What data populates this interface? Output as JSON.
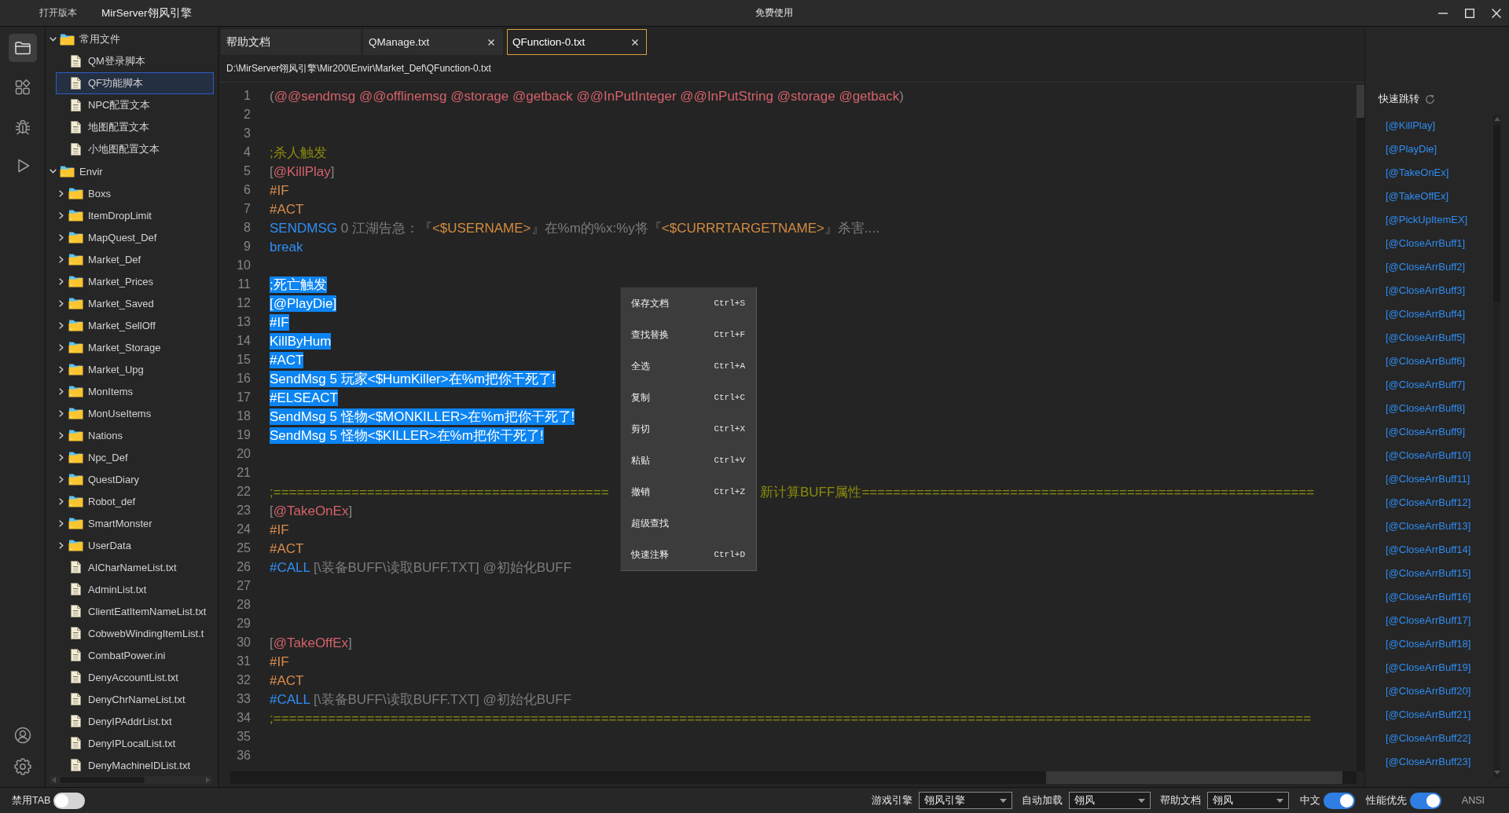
{
  "title_bar": {
    "menu": "打开版本",
    "app_name": "MirServer翎风引擎",
    "notice": "免费使用"
  },
  "activity_bar": {
    "top": [
      {
        "kind": "explorer",
        "selected": true
      },
      {
        "kind": "extensions",
        "selected": false
      },
      {
        "kind": "debug",
        "selected": false
      },
      {
        "kind": "run",
        "selected": false
      }
    ],
    "bottom": [
      {
        "kind": "account"
      },
      {
        "kind": "settings"
      }
    ]
  },
  "explorer": {
    "tree": [
      {
        "label": "常用文件",
        "kind": "folder",
        "expanded": true,
        "selected": false,
        "children": [
          {
            "label": "QM登录脚本",
            "kind": "file",
            "selected": false
          },
          {
            "label": "QF功能脚本",
            "kind": "file",
            "selected": true
          },
          {
            "label": "NPC配置文本",
            "kind": "file",
            "selected": false
          },
          {
            "label": "地图配置文本",
            "kind": "file",
            "selected": false
          },
          {
            "label": "小地图配置文本",
            "kind": "file",
            "selected": false
          }
        ]
      },
      {
        "label": "Envir",
        "kind": "folder",
        "expanded": true,
        "selected": false,
        "children": [
          {
            "label": "Boxs",
            "kind": "folder",
            "expanded": false,
            "selected": false
          },
          {
            "label": "ItemDropLimit",
            "kind": "folder",
            "expanded": false,
            "selected": false
          },
          {
            "label": "MapQuest_Def",
            "kind": "folder",
            "expanded": false,
            "selected": false
          },
          {
            "label": "Market_Def",
            "kind": "folder",
            "expanded": false,
            "selected": false
          },
          {
            "label": "Market_Prices",
            "kind": "folder",
            "expanded": false,
            "selected": false
          },
          {
            "label": "Market_Saved",
            "kind": "folder",
            "expanded": false,
            "selected": false
          },
          {
            "label": "Market_SellOff",
            "kind": "folder",
            "expanded": false,
            "selected": false
          },
          {
            "label": "Market_Storage",
            "kind": "folder",
            "expanded": false,
            "selected": false
          },
          {
            "label": "Market_Upg",
            "kind": "folder",
            "expanded": false,
            "selected": false
          },
          {
            "label": "MonItems",
            "kind": "folder",
            "expanded": false,
            "selected": false
          },
          {
            "label": "MonUseItems",
            "kind": "folder",
            "expanded": false,
            "selected": false
          },
          {
            "label": "Nations",
            "kind": "folder",
            "expanded": false,
            "selected": false
          },
          {
            "label": "Npc_Def",
            "kind": "folder",
            "expanded": false,
            "selected": false
          },
          {
            "label": "QuestDiary",
            "kind": "folder",
            "expanded": false,
            "selected": false
          },
          {
            "label": "Robot_def",
            "kind": "folder",
            "expanded": false,
            "selected": false
          },
          {
            "label": "SmartMonster",
            "kind": "folder",
            "expanded": false,
            "selected": false
          },
          {
            "label": "UserData",
            "kind": "folder",
            "expanded": false,
            "selected": false
          },
          {
            "label": "AICharNameList.txt",
            "kind": "file",
            "selected": false
          },
          {
            "label": "AdminList.txt",
            "kind": "file",
            "selected": false
          },
          {
            "label": "ClientEatItemNameList.txt",
            "kind": "file",
            "selected": false
          },
          {
            "label": "CobwebWindingItemList.t",
            "kind": "file",
            "selected": false
          },
          {
            "label": "CombatPower.ini",
            "kind": "file",
            "selected": false
          },
          {
            "label": "DenyAccountList.txt",
            "kind": "file",
            "selected": false
          },
          {
            "label": "DenyChrNameList.txt",
            "kind": "file",
            "selected": false
          },
          {
            "label": "DenyIPAddrList.txt",
            "kind": "file",
            "selected": false
          },
          {
            "label": "DenyIPLocalList.txt",
            "kind": "file",
            "selected": false
          },
          {
            "label": "DenyMachineIDList.txt",
            "kind": "file",
            "selected": false
          }
        ]
      }
    ]
  },
  "editor": {
    "tabs": [
      {
        "label": "帮助文档",
        "closable": false,
        "selected": false
      },
      {
        "label": "QManage.txt",
        "closable": true,
        "selected": false
      },
      {
        "label": "QFunction-0.txt",
        "closable": true,
        "selected": true
      }
    ],
    "path": "D:\\MirServer翎风引擎\\Mir200\\Envir\\Market_Def\\QFunction-0.txt",
    "lines": [
      {
        "number": "1",
        "selected": false,
        "segments": [
          {
            "kind": "punct",
            "text": "("
          },
          {
            "kind": "label",
            "text": "@@sendmsg @@offlinemsg @storage @getback @@InPutInteger @@InPutString @storage @getback"
          },
          {
            "kind": "punct",
            "text": ")"
          }
        ]
      },
      {
        "number": "2",
        "selected": false
      },
      {
        "number": "3",
        "selected": false
      },
      {
        "number": "4",
        "selected": false,
        "segments": [
          {
            "kind": "comment",
            "text": ";杀人触发"
          }
        ]
      },
      {
        "number": "5",
        "selected": false,
        "segments": [
          {
            "kind": "punct",
            "text": "["
          },
          {
            "kind": "label",
            "text": "@KillPlay"
          },
          {
            "kind": "punct",
            "text": "]"
          }
        ]
      },
      {
        "number": "6",
        "selected": false,
        "segments": [
          {
            "kind": "directive",
            "text": "#IF"
          }
        ]
      },
      {
        "number": "7",
        "selected": false,
        "segments": [
          {
            "kind": "directive",
            "text": "#ACT"
          }
        ]
      },
      {
        "number": "8",
        "selected": false,
        "segments": [
          {
            "kind": "command",
            "text": "SENDMSG"
          },
          {
            "kind": "text",
            "text": " 0 江湖告急：『"
          },
          {
            "kind": "variable",
            "text": "<$USERNAME>"
          },
          {
            "kind": "text",
            "text": "』在%m的%x:%y将『"
          },
          {
            "kind": "variable",
            "text": "<$CURRRTARGETNAME>"
          },
          {
            "kind": "text",
            "text": "』杀害...."
          }
        ]
      },
      {
        "number": "9",
        "selected": false,
        "segments": [
          {
            "kind": "command",
            "text": "break"
          }
        ]
      },
      {
        "number": "10",
        "selected": false
      },
      {
        "number": "11",
        "selected": true,
        "text": ";死亡触发"
      },
      {
        "number": "12",
        "selected": true,
        "text": "[@PlayDie]"
      },
      {
        "number": "13",
        "selected": true,
        "text": "#IF"
      },
      {
        "number": "14",
        "selected": true,
        "text": "KillByHum"
      },
      {
        "number": "15",
        "selected": true,
        "text": "#ACT"
      },
      {
        "number": "16",
        "selected": true,
        "text": "SendMsg 5 玩家<$HumKiller>在%m把你干死了!"
      },
      {
        "number": "17",
        "selected": true,
        "text": "#ELSEACT"
      },
      {
        "number": "18",
        "selected": true,
        "text": "SendMsg 5 怪物<$MONKILLER>在%m把你干死了!"
      },
      {
        "number": "19",
        "selected": true,
        "text": "SendMsg 5 怪物<$KILLER>在%m把你干死了!"
      },
      {
        "number": "20",
        "selected": false
      },
      {
        "number": "21",
        "selected": false
      },
      {
        "number": "22",
        "selected": false,
        "segments": [
          {
            "kind": "comment",
            "text": ";===========================================",
            "after_menu": false
          },
          {
            "kind": "comment",
            "text": "新计算BUFF属性==========================================================",
            "after_menu": true
          }
        ]
      },
      {
        "number": "23",
        "selected": false,
        "segments": [
          {
            "kind": "punct",
            "text": "["
          },
          {
            "kind": "label",
            "text": "@TakeOnEx"
          },
          {
            "kind": "punct",
            "text": "]"
          }
        ]
      },
      {
        "number": "24",
        "selected": false,
        "segments": [
          {
            "kind": "directive",
            "text": "#IF"
          }
        ]
      },
      {
        "number": "25",
        "selected": false,
        "segments": [
          {
            "kind": "directive",
            "text": "#ACT"
          }
        ]
      },
      {
        "number": "26",
        "selected": false,
        "segments": [
          {
            "kind": "command",
            "text": "#CALL"
          },
          {
            "kind": "text",
            "text": " [\\装备BUFF\\读取BUFF.TXT] @初始化BUFF"
          }
        ]
      },
      {
        "number": "27",
        "selected": false
      },
      {
        "number": "28",
        "selected": false
      },
      {
        "number": "29",
        "selected": false
      },
      {
        "number": "30",
        "selected": false,
        "segments": [
          {
            "kind": "punct",
            "text": "["
          },
          {
            "kind": "label",
            "text": "@TakeOffEx"
          },
          {
            "kind": "punct",
            "text": "]"
          }
        ]
      },
      {
        "number": "31",
        "selected": false,
        "segments": [
          {
            "kind": "directive",
            "text": "#IF"
          }
        ]
      },
      {
        "number": "32",
        "selected": false,
        "segments": [
          {
            "kind": "directive",
            "text": "#ACT"
          }
        ]
      },
      {
        "number": "33",
        "selected": false,
        "segments": [
          {
            "kind": "command",
            "text": "#CALL"
          },
          {
            "kind": "text",
            "text": " [\\装备BUFF\\读取BUFF.TXT] @初始化BUFF"
          }
        ]
      },
      {
        "number": "34",
        "selected": false,
        "segments": [
          {
            "kind": "comment",
            "text": ";====================================================================================================================================="
          }
        ]
      },
      {
        "number": "35",
        "selected": false
      },
      {
        "number": "36",
        "selected": false
      }
    ]
  },
  "context_menu": {
    "items": [
      {
        "label": "保存文档",
        "shortcut": "Ctrl+S"
      },
      {
        "label": "查找替换",
        "shortcut": "Ctrl+F"
      },
      {
        "label": "全选",
        "shortcut": "Ctrl+A"
      },
      {
        "label": "复制",
        "shortcut": "Ctrl+C"
      },
      {
        "label": "剪切",
        "shortcut": "Ctrl+X"
      },
      {
        "label": "粘贴",
        "shortcut": "Ctrl+V"
      },
      {
        "label": "撤销",
        "shortcut": "Ctrl+Z"
      },
      {
        "label": "超级查找"
      },
      {
        "label": "快速注释",
        "shortcut": "Ctrl+D"
      }
    ]
  },
  "quick_jump": {
    "title": "快速跳转",
    "links": [
      "[@KillPlay]",
      "[@PlayDie]",
      "[@TakeOnEx]",
      "[@TakeOffEx]",
      "[@PickUpItemEX]",
      "[@CloseArrBuff1]",
      "[@CloseArrBuff2]",
      "[@CloseArrBuff3]",
      "[@CloseArrBuff4]",
      "[@CloseArrBuff5]",
      "[@CloseArrBuff6]",
      "[@CloseArrBuff7]",
      "[@CloseArrBuff8]",
      "[@CloseArrBuff9]",
      "[@CloseArrBuff10]",
      "[@CloseArrBuff11]",
      "[@CloseArrBuff12]",
      "[@CloseArrBuff13]",
      "[@CloseArrBuff14]",
      "[@CloseArrBuff15]",
      "[@CloseArrBuff16]",
      "[@CloseArrBuff17]",
      "[@CloseArrBuff18]",
      "[@CloseArrBuff19]",
      "[@CloseArrBuff20]",
      "[@CloseArrBuff21]",
      "[@CloseArrBuff22]",
      "[@CloseArrBuff23]"
    ]
  },
  "status_bar": {
    "left": [
      {
        "kind": "toggle",
        "label": "禁用TAB",
        "on": false
      }
    ],
    "right": [
      {
        "kind": "select",
        "label": "游戏引擎",
        "value": "翎风引擎"
      },
      {
        "kind": "select",
        "label": "自动加载",
        "value": "翎风"
      },
      {
        "kind": "select",
        "label": "帮助文档",
        "value": "翎风"
      },
      {
        "kind": "toggle",
        "label": "中文",
        "on": true
      },
      {
        "kind": "toggle",
        "label": "性能优先",
        "on": true
      },
      {
        "kind": "text",
        "label": "ANSI"
      }
    ]
  }
}
